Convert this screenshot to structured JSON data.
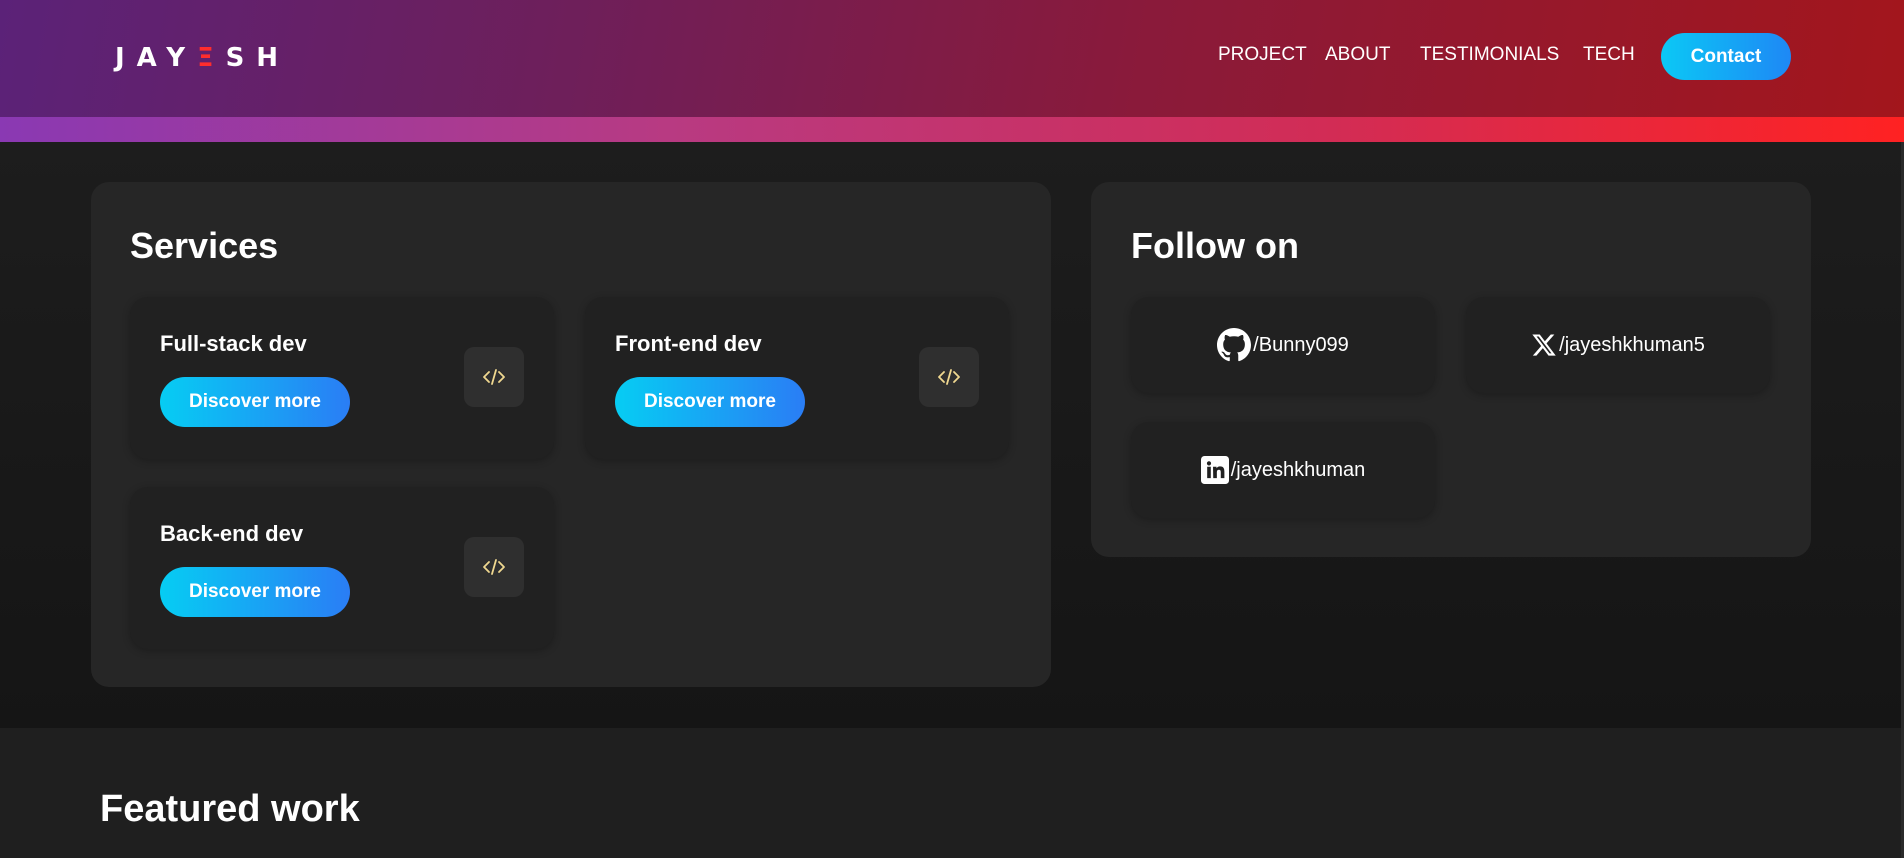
{
  "logo": {
    "part1": "JAY",
    "accent": "Ξ",
    "part2": "SH"
  },
  "nav": {
    "items": [
      {
        "label": "PROJECT"
      },
      {
        "label": "ABOUT"
      },
      {
        "label": "TESTIMONIALS"
      },
      {
        "label": "TECH"
      }
    ],
    "contact_label": "Contact"
  },
  "services": {
    "title": "Services",
    "cards": [
      {
        "title": "Full-stack dev",
        "button": "Discover more",
        "icon": "code-icon"
      },
      {
        "title": "Front-end dev",
        "button": "Discover more",
        "icon": "code-icon"
      },
      {
        "title": "Back-end dev",
        "button": "Discover more",
        "icon": "code-icon"
      }
    ]
  },
  "follow": {
    "title": "Follow on",
    "links": [
      {
        "label": "/Bunny099",
        "icon": "github-icon"
      },
      {
        "label": "/jayeshkhuman5",
        "icon": "x-icon"
      },
      {
        "label": "/jayeshkhuman",
        "icon": "linkedin-icon"
      }
    ]
  },
  "featured": {
    "title": "Featured work"
  },
  "colors": {
    "header_start": "#5b2278",
    "header_end": "#a3161c",
    "button_start": "#06cdf3",
    "button_end": "#2a7df5",
    "logo_accent": "#ff2d2d",
    "panel_bg": "#262626",
    "card_bg": "#212121",
    "code_icon": "#f0d890"
  }
}
